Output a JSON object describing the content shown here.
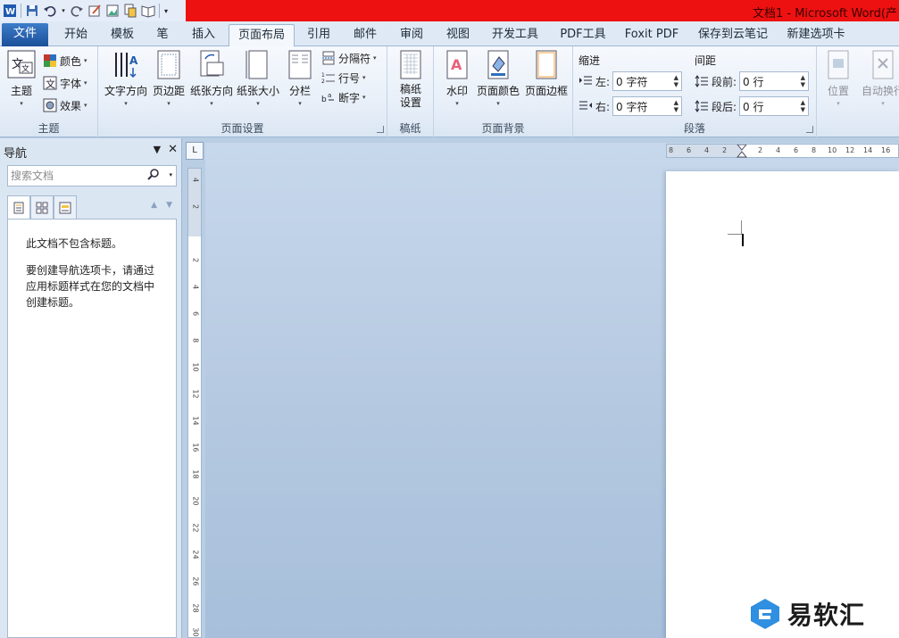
{
  "window": {
    "title": "文档1  -  Microsoft Word(产"
  },
  "tabs": [
    {
      "label": "文件"
    },
    {
      "label": "开始"
    },
    {
      "label": "模板"
    },
    {
      "label": "笔"
    },
    {
      "label": "插入"
    },
    {
      "label": "页面布局"
    },
    {
      "label": "引用"
    },
    {
      "label": "邮件"
    },
    {
      "label": "审阅"
    },
    {
      "label": "视图"
    },
    {
      "label": "开发工具"
    },
    {
      "label": "PDF工具"
    },
    {
      "label": "Foxit PDF"
    },
    {
      "label": "保存到云笔记"
    },
    {
      "label": "新建选项卡"
    }
  ],
  "ribbon": {
    "theme": {
      "label": "主题",
      "theme_btn": "主题",
      "colors": "颜色",
      "fonts": "字体",
      "effects": "效果"
    },
    "page_setup": {
      "label": "页面设置",
      "text_direction": "文字方向",
      "margins": "页边距",
      "orientation": "纸张方向",
      "size": "纸张大小",
      "columns": "分栏",
      "breaks": "分隔符",
      "line_numbers": "行号",
      "hyphenation": "断字"
    },
    "manuscript": {
      "label": "稿纸",
      "settings": "稿纸\n设置"
    },
    "page_background": {
      "label": "页面背景",
      "watermark": "水印",
      "page_color": "页面颜色",
      "page_borders": "页面边框"
    },
    "paragraph": {
      "label": "段落",
      "indent": "缩进",
      "spacing": "间距",
      "left": "左:",
      "right": "右:",
      "before": "段前:",
      "after": "段后:",
      "left_value": "0 字符",
      "right_value": "0 字符",
      "before_value": "0 行",
      "after_value": "0 行"
    },
    "arrange": {
      "position": "位置",
      "wrap": "自动换行"
    }
  },
  "navigation": {
    "title": "导航",
    "search_placeholder": "搜索文档",
    "message1": "此文档不包含标题。",
    "message2": "要创建导航选项卡，请通过应用标题样式在您的文档中创建标题。"
  },
  "rulers": {
    "horizontal": [
      "8",
      "6",
      "4",
      "2",
      "2",
      "4",
      "6",
      "8",
      "10",
      "12",
      "14",
      "16"
    ],
    "vertical": [
      "4",
      "2",
      "2",
      "4",
      "6",
      "8",
      "10",
      "12",
      "14",
      "16",
      "18",
      "20",
      "22",
      "24",
      "26",
      "28",
      "30"
    ]
  },
  "watermark_brand": {
    "text": "易软汇"
  },
  "colors": {
    "title_red": "#ee1111",
    "file_tab": "#2a62b0",
    "ribbon_bg": "#e6eef8",
    "doc_bg": "#b4c8e0"
  }
}
